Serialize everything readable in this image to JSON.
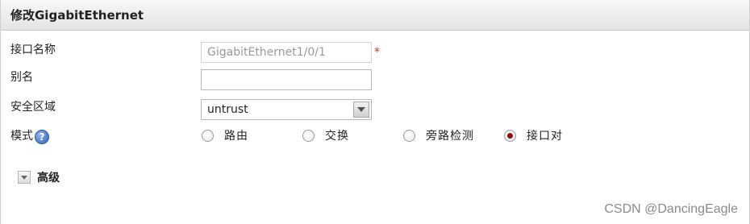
{
  "dialog": {
    "title": "修改GigabitEthernet"
  },
  "form": {
    "interface_name": {
      "label": "接口名称",
      "value": "GigabitEthernet1/0/1",
      "required_mark": "*"
    },
    "alias": {
      "label": "别名",
      "value": ""
    },
    "security_zone": {
      "label": "安全区域",
      "selected": "untrust"
    },
    "mode": {
      "label": "模式",
      "help_icon": "help-icon",
      "options": [
        {
          "label": "路由",
          "checked": false
        },
        {
          "label": "交换",
          "checked": false
        },
        {
          "label": "旁路检测",
          "checked": false
        },
        {
          "label": "接口对",
          "checked": true
        }
      ]
    },
    "advanced": {
      "label": "高级",
      "expanded": false
    }
  },
  "watermark": "CSDN @DancingEagle",
  "colors": {
    "required": "#e03030",
    "radio_checked": "#8b1212",
    "help_icon": "#2f63b7"
  }
}
